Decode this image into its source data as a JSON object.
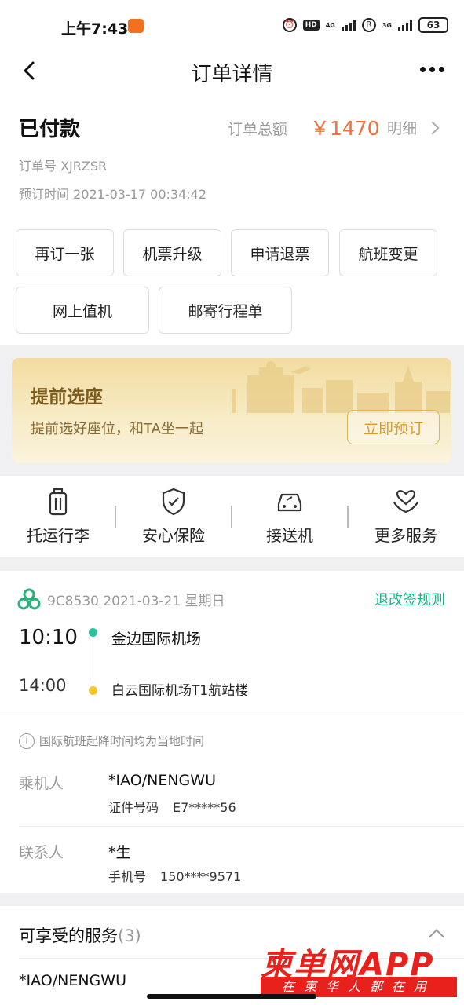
{
  "status_bar": {
    "time": "上午7:43",
    "hd": "HD",
    "net1": "4G",
    "net2": "3G",
    "r_icon": "R",
    "battery": "63"
  },
  "nav": {
    "title": "订单详情"
  },
  "order": {
    "status": "已付款",
    "total_label": "订单总额",
    "total_amount": "￥1470",
    "detail_label": "明细",
    "order_no": "订单号  XJRZSR",
    "order_time": "预订时间  2021-03-17 00:34:42",
    "actions": [
      "再订一张",
      "机票升级",
      "申请退票",
      "航班变更",
      "网上值机",
      "邮寄行程单"
    ]
  },
  "seat_banner": {
    "title": "提前选座",
    "subtitle": "提前选好座位，和TA坐一起",
    "button": "立即预订"
  },
  "services": [
    {
      "label": "托运行李",
      "icon": "luggage-icon"
    },
    {
      "label": "安心保险",
      "icon": "shield-check-icon"
    },
    {
      "label": "接送机",
      "icon": "car-icon"
    },
    {
      "label": "更多服务",
      "icon": "heart-hands-icon"
    }
  ],
  "flight": {
    "info": "9C8530  2021-03-21 星期日",
    "rules_link": "退改签规则",
    "dep_time": "10:10",
    "dep_airport": "金边国际机场",
    "arr_time": "14:00",
    "arr_airport": "白云国际机场T1航站楼",
    "notice": "国际航班起降时间均为当地时间",
    "passenger_label": "乘机人",
    "passenger_name": "*IAO/NENGWU",
    "passenger_id_label": "证件号码",
    "passenger_id": "E7*****56",
    "contact_label": "联系人",
    "contact_name": "*生",
    "contact_phone_label": "手机号",
    "contact_phone": "150****9571"
  },
  "bottom": {
    "services_title": "可享受的服务",
    "services_count": "(3)",
    "name": "*IAO/NENGWU"
  },
  "watermark": {
    "top": "柬单网APP",
    "bottom": "在柬华人都在用"
  },
  "colors": {
    "accent_orange": "#f0703a",
    "accent_green": "#1bb38a",
    "banner_gold": "#f2dca0",
    "watermark_red": "#e8211d"
  }
}
